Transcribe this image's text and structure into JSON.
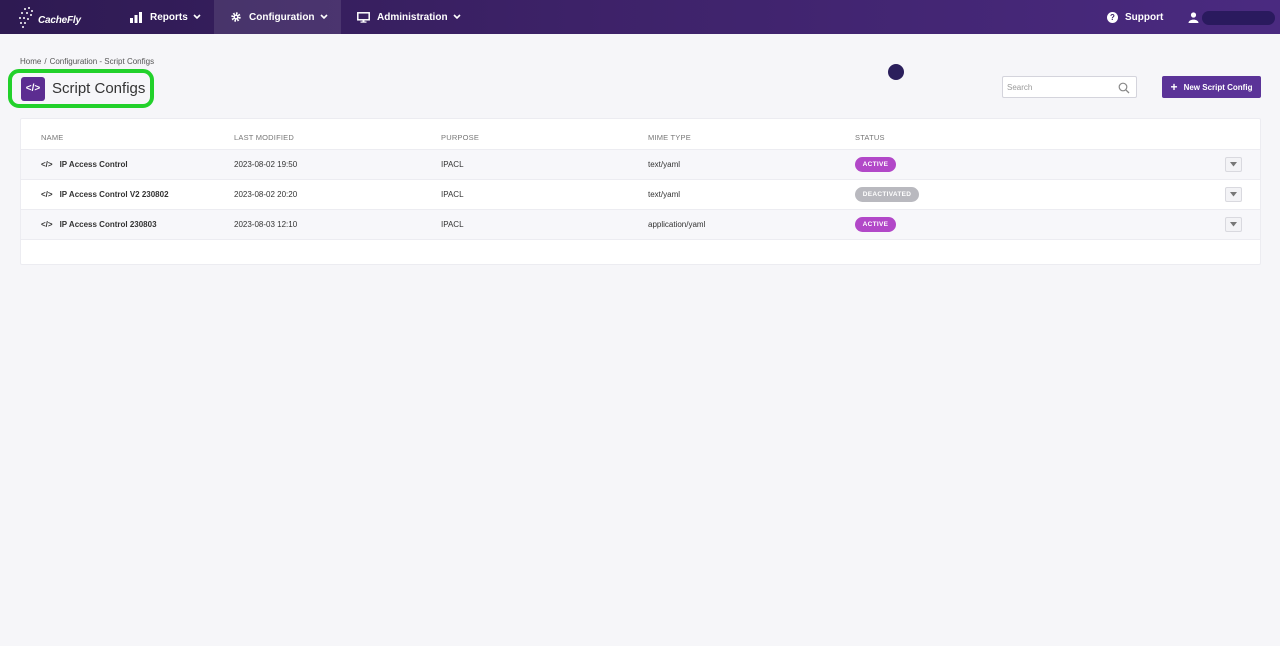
{
  "nav": {
    "logo": "CacheFly",
    "reports_label": "Reports",
    "configuration_label": "Configuration",
    "administration_label": "Administration",
    "support_label": "Support",
    "support_icon_glyph": "?"
  },
  "breadcrumb": {
    "home": "Home",
    "separator": "/",
    "current": "Configuration - Script Configs"
  },
  "page": {
    "title": "Script Configs",
    "title_icon_glyph": "</>"
  },
  "search": {
    "placeholder": "Search"
  },
  "new_button": {
    "plus": "+",
    "label": "New Script Config"
  },
  "table": {
    "headers": {
      "name": "NAME",
      "last_modified": "LAST MODIFIED",
      "purpose": "PURPOSE",
      "mime_type": "MIME TYPE",
      "status": "STATUS"
    },
    "code_glyph": "</>",
    "rows": [
      {
        "name": "IP Access Control",
        "last_modified": "2023-08-02 19:50",
        "purpose": "IPACL",
        "mime_type": "text/yaml",
        "status": "ACTIVE"
      },
      {
        "name": "IP Access Control V2 230802",
        "last_modified": "2023-08-02 20:20",
        "purpose": "IPACL",
        "mime_type": "text/yaml",
        "status": "DEACTIVATED"
      },
      {
        "name": "IP Access Control 230803",
        "last_modified": "2023-08-03 12:10",
        "purpose": "IPACL",
        "mime_type": "application/yaml",
        "status": "ACTIVE"
      }
    ]
  },
  "colors": {
    "nav_bg": "#3d2268",
    "accent": "#5b3398",
    "active_badge": "#b248c8",
    "deactivated_badge": "#b9b9bf",
    "highlight": "#22d12b"
  }
}
